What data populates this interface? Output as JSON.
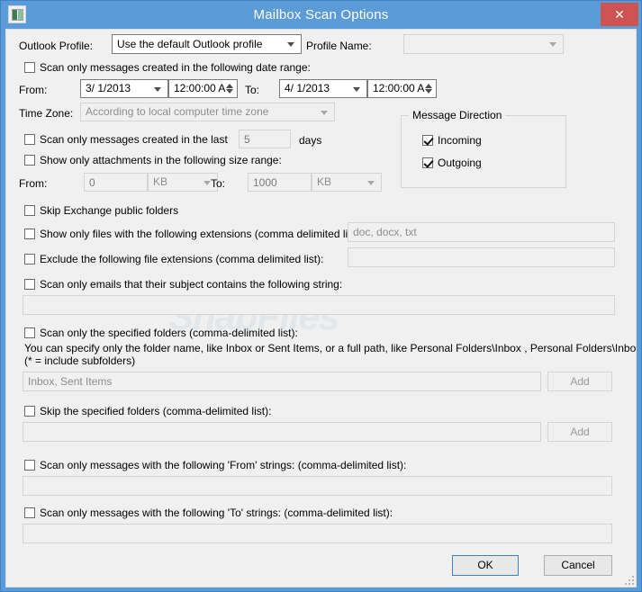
{
  "window": {
    "title": "Mailbox Scan Options",
    "icon": "mailbox-window-icon",
    "close_label": "✕",
    "accent_color": "#5b9bd8",
    "close_color": "#d05353",
    "watermark": "SnapFiles"
  },
  "profile_row": {
    "outlook_profile_label": "Outlook Profile:",
    "outlook_profile_value": "Use the default Outlook profile",
    "profile_name_label": "Profile Name:",
    "profile_name_value": ""
  },
  "date_range": {
    "checkbox_label": "Scan only messages created in the following date range:",
    "checked": false,
    "from_label": "From:",
    "from_date": "3/  1/2013",
    "from_time": "12:00:00 A",
    "to_label": "To:",
    "to_date": "4/  1/2013",
    "to_time": "12:00:00 A",
    "time_zone_label": "Time Zone:",
    "time_zone_value": "According to local computer time zone"
  },
  "last_days": {
    "checkbox_label": "Scan only messages created in the last",
    "checked": false,
    "value": "5",
    "unit_label": "days"
  },
  "size_range": {
    "checkbox_label": "Show only attachments in the following size range:",
    "checked": false,
    "from_label": "From:",
    "from_value": "0",
    "from_unit": "KB",
    "to_label": "To:",
    "to_value": "1000",
    "to_unit": "KB"
  },
  "message_direction": {
    "group_title": "Message Direction",
    "incoming_label": "Incoming",
    "incoming_checked": true,
    "outgoing_label": "Outgoing",
    "outgoing_checked": true
  },
  "skip_public_folders": {
    "checkbox_label": "Skip Exchange public folders",
    "checked": false
  },
  "include_extensions": {
    "checkbox_label": "Show only files with the following extensions (comma delimited list):",
    "checked": false,
    "value": "",
    "placeholder": "doc, docx, txt"
  },
  "exclude_extensions": {
    "checkbox_label": "Exclude the following file extensions (comma delimited list):",
    "checked": false,
    "value": "",
    "placeholder": ""
  },
  "subject_contains": {
    "checkbox_label": "Scan only emails that their subject contains the following string:",
    "checked": false,
    "value": "",
    "placeholder": ""
  },
  "specified_folders": {
    "checkbox_label": "Scan only the specified folders (comma-delimited list):",
    "checked": false,
    "help_line1": "You can specify only the folder name, like Inbox or Sent Items, or a full path, like Personal Folders\\Inbox , Personal Folders\\Inbox*",
    "help_line2": " (* = include subfolders)",
    "value": "",
    "placeholder": "Inbox, Sent Items",
    "add_label": "Add"
  },
  "skip_folders": {
    "checkbox_label": "Skip the specified folders (comma-delimited list):",
    "checked": false,
    "value": "",
    "placeholder": "",
    "add_label": "Add"
  },
  "from_strings": {
    "checkbox_label": "Scan only messages with the following 'From' strings: (comma-delimited list):",
    "checked": false,
    "value": "",
    "placeholder": ""
  },
  "to_strings": {
    "checkbox_label": "Scan only messages with the following 'To' strings: (comma-delimited list):",
    "checked": false,
    "value": "",
    "placeholder": ""
  },
  "footer": {
    "ok_label": "OK",
    "cancel_label": "Cancel"
  }
}
